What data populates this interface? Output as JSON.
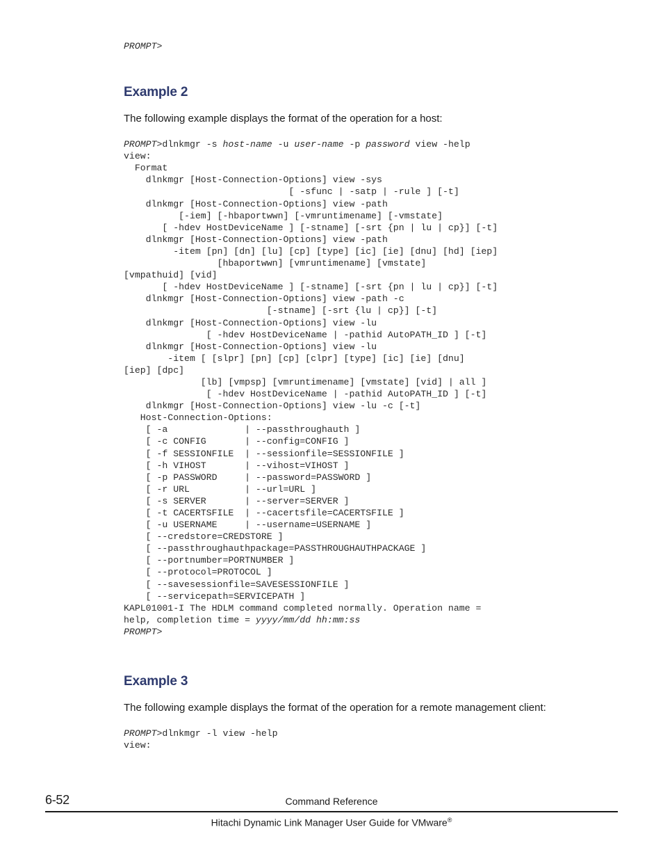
{
  "page": {
    "top_prompt": "PROMPT>",
    "sections": [
      {
        "heading": "Example 2",
        "paragraph": "The following example displays the format of the operation for a host:",
        "code_lines": [
          "PROMPT>dlnkmgr -s host-name -u user-name -p password view -help",
          "view:",
          "  Format",
          "    dlnkmgr [Host-Connection-Options] view -sys",
          "                              [ -sfunc | -satp | -rule ] [-t]",
          "    dlnkmgr [Host-Connection-Options] view -path",
          "          [-iem] [-hbaportwwn] [-vmruntimename] [-vmstate]",
          "       [ -hdev HostDeviceName ] [-stname] [-srt {pn | lu | cp}] [-t]",
          "    dlnkmgr [Host-Connection-Options] view -path",
          "         -item [pn] [dn] [lu] [cp] [type] [ic] [ie] [dnu] [hd] [iep]",
          "                 [hbaportwwn] [vmruntimename] [vmstate]",
          "[vmpathuid] [vid]",
          "       [ -hdev HostDeviceName ] [-stname] [-srt {pn | lu | cp}] [-t]",
          "    dlnkmgr [Host-Connection-Options] view -path -c",
          "                          [-stname] [-srt {lu | cp}] [-t]",
          "    dlnkmgr [Host-Connection-Options] view -lu",
          "               [ -hdev HostDeviceName | -pathid AutoPATH_ID ] [-t]",
          "    dlnkmgr [Host-Connection-Options] view -lu",
          "        -item [ [slpr] [pn] [cp] [clpr] [type] [ic] [ie] [dnu]",
          "[iep] [dpc]",
          "              [lb] [vmpsp] [vmruntimename] [vmstate] [vid] | all ]",
          "               [ -hdev HostDeviceName | -pathid AutoPATH_ID ] [-t]",
          "    dlnkmgr [Host-Connection-Options] view -lu -c [-t]",
          "   Host-Connection-Options:",
          "    [ -a              | --passthroughauth ]",
          "    [ -c CONFIG       | --config=CONFIG ]",
          "    [ -f SESSIONFILE  | --sessionfile=SESSIONFILE ]",
          "    [ -h VIHOST       | --vihost=VIHOST ]",
          "    [ -p PASSWORD     | --password=PASSWORD ]",
          "    [ -r URL          | --url=URL ]",
          "    [ -s SERVER       | --server=SERVER ]",
          "    [ -t CACERTSFILE  | --cacertsfile=CACERTSFILE ]",
          "    [ -u USERNAME     | --username=USERNAME ]",
          "    [ --credstore=CREDSTORE ]",
          "    [ --passthroughauthpackage=PASSTHROUGHAUTHPACKAGE ]",
          "    [ --portnumber=PORTNUMBER ]",
          "    [ --protocol=PROTOCOL ]",
          "    [ --savesessionfile=SAVESESSIONFILE ]",
          "    [ --servicepath=SERVICEPATH ]",
          "KAPL01001-I The HDLM command completed normally. Operation name =",
          "help, completion time = yyyy/mm/dd hh:mm:ss",
          "PROMPT>"
        ]
      },
      {
        "heading": "Example 3",
        "paragraph": "The following example displays the format of the operation for a remote management client:",
        "code_lines": [
          "PROMPT>dlnkmgr -l view -help",
          "view:"
        ]
      }
    ]
  },
  "footer": {
    "page_number": "6-52",
    "section_name": "Command Reference",
    "document_title": "Hitachi Dynamic Link Manager User Guide for VMware",
    "trademark": "®"
  },
  "colors": {
    "heading": "#2e3a6e",
    "body_text": "#1a1a1a",
    "code_text": "#2b2b2b",
    "rule": "#1a1a1a"
  }
}
